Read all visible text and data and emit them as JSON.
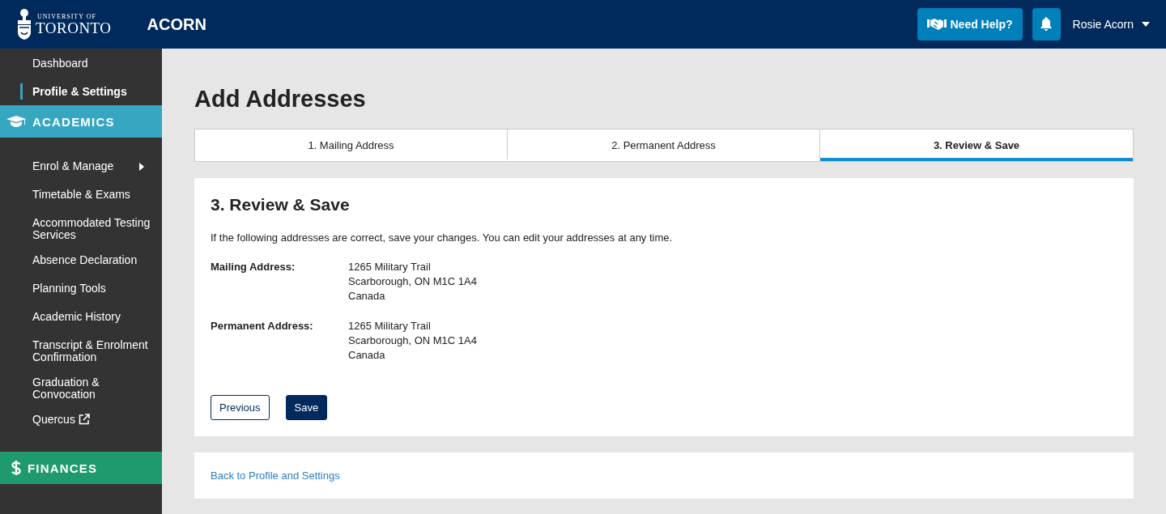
{
  "header": {
    "logo_top": "UNIVERSITY OF",
    "logo_bottom": "TORONTO",
    "app_name": "ACORN",
    "help_button": "Need Help?",
    "user_menu": "Rosie Acorn"
  },
  "sidebar": {
    "top_items": [
      {
        "label": "Dashboard",
        "selected": false
      },
      {
        "label": "Profile & Settings",
        "selected": true
      }
    ],
    "sections": [
      {
        "kind": "academics",
        "title": "ACADEMICS",
        "items": [
          {
            "label": "Enrol & Manage",
            "kind": "submenu"
          },
          {
            "label": "Timetable & Exams",
            "kind": "link"
          },
          {
            "label": "Accommodated Testing Services",
            "kind": "link"
          },
          {
            "label": "Absence Declaration",
            "kind": "link"
          },
          {
            "label": "Planning Tools",
            "kind": "link"
          },
          {
            "label": "Academic History",
            "kind": "link"
          },
          {
            "label": "Transcript & Enrolment Confirmation",
            "kind": "link"
          },
          {
            "label": "Graduation & Convocation",
            "kind": "link"
          },
          {
            "label": "Quercus",
            "kind": "external"
          }
        ]
      },
      {
        "kind": "finances",
        "title": "FINANCES"
      }
    ]
  },
  "page": {
    "title": "Add Addresses",
    "steps": [
      {
        "label": "1. Mailing Address",
        "selected": false
      },
      {
        "label": "2. Permanent Address",
        "selected": false
      },
      {
        "label": "3. Review & Save",
        "selected": true
      }
    ],
    "card": {
      "heading": "3. Review & Save",
      "intro": "If the following addresses are correct, save your changes. You can edit your addresses at any time.",
      "addresses": [
        {
          "label": "Mailing Address:",
          "lines": [
            "1265 Military Trail",
            "Scarborough, ON M1C 1A4",
            "Canada"
          ]
        },
        {
          "label": "Permanent Address:",
          "lines": [
            "1265 Military Trail",
            "Scarborough, ON M1C 1A4",
            "Canada"
          ]
        }
      ],
      "buttons": [
        {
          "label": "Previous",
          "kind": "secondary"
        },
        {
          "label": "Save",
          "kind": "primary"
        }
      ]
    },
    "back_link": "Back to Profile and Settings"
  }
}
